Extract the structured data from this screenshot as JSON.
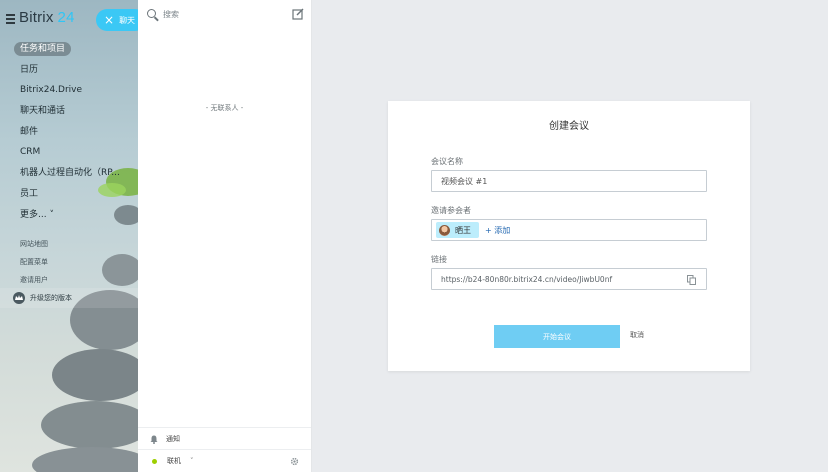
{
  "sidebar": {
    "logo_brand": "Bitrix",
    "logo_number": "24",
    "chat_pill_label": "聊天",
    "menu_items": [
      "任务和项目",
      "日历",
      "Bitrix24.Drive",
      "聊天和通话",
      "邮件",
      "CRM",
      "机器人过程自动化（RP...",
      "员工",
      "更多... ˅"
    ],
    "secondary_items": [
      "网站地图",
      "配置菜单",
      "邀请用户"
    ],
    "upgrade_label": "升级您的版本"
  },
  "contacts_panel": {
    "search_placeholder": "搜索",
    "empty_text": "- 无联系人 -",
    "notifications_label": "通知",
    "status_label": "联机",
    "status_color": "#9dcf00"
  },
  "modal": {
    "title": "创建会议",
    "name_label": "会议名称",
    "name_value": "视频会议 #1",
    "invite_label": "邀请参会者",
    "invitee_name": "晒王",
    "add_label": "+ 添加",
    "link_label": "链接",
    "link_value": "https://b24-80n80r.bitrix24.cn/video/JiwbU0nf",
    "start_button": "开始会议",
    "cancel_button": "取消"
  },
  "colors": {
    "accent": "#3bc8f5",
    "start_button": "#6fcdf3",
    "chip": "#bcedfc",
    "link": "#2066b0"
  }
}
